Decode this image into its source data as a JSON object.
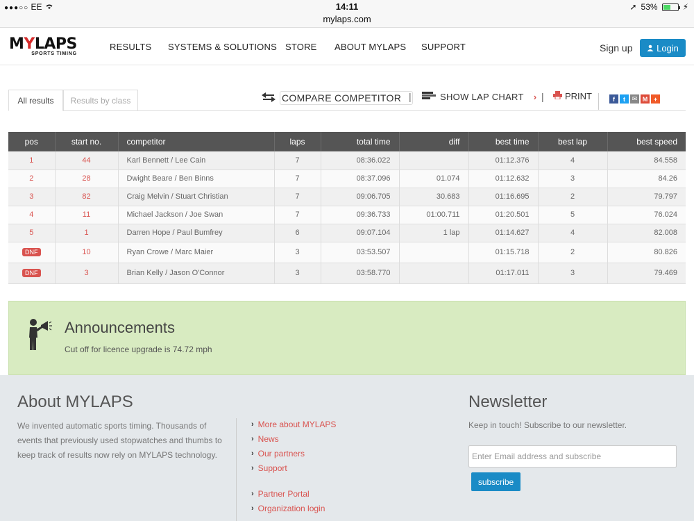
{
  "status_bar": {
    "carrier": "EE",
    "time": "14:11",
    "url": "mylaps.com",
    "battery": "53%",
    "battery_level": 0.53
  },
  "nav": {
    "logo_text": "MYLAPS",
    "logo_tagline": "SPORTS TIMING",
    "items": [
      "RESULTS",
      "SYSTEMS & SOLUTIONS",
      "STORE",
      "ABOUT MYLAPS",
      "SUPPORT"
    ],
    "signup": "Sign up",
    "login": "Login"
  },
  "tabs": {
    "all_results": "All results",
    "results_by_class": "Results by class"
  },
  "toolbar": {
    "compare": "COMPARE COMPETITOR",
    "lap_chart": "SHOW LAP CHART",
    "print": "PRINT",
    "separator": "|",
    "chevron": "›"
  },
  "share_icons": [
    {
      "name": "facebook-icon",
      "color": "#3b5998",
      "glyph": "f"
    },
    {
      "name": "twitter-icon",
      "color": "#1da1f2",
      "glyph": "t"
    },
    {
      "name": "email-icon",
      "color": "#888888",
      "glyph": "✉"
    },
    {
      "name": "gmail-icon",
      "color": "#dd4b39",
      "glyph": "M"
    },
    {
      "name": "more-share-icon",
      "color": "#f05a28",
      "glyph": "+"
    }
  ],
  "table": {
    "headers": [
      "pos",
      "start no.",
      "competitor",
      "laps",
      "total time",
      "diff",
      "best time",
      "best lap",
      "best speed"
    ],
    "rows": [
      {
        "pos": "1",
        "start": "44",
        "competitor": "Karl Bennett / Lee Cain",
        "laps": "7",
        "total": "08:36.022",
        "diff": "",
        "best_time": "01:12.376",
        "best_lap": "4",
        "speed": "84.558"
      },
      {
        "pos": "2",
        "start": "28",
        "competitor": "Dwight Beare / Ben Binns",
        "laps": "7",
        "total": "08:37.096",
        "diff": "01.074",
        "best_time": "01:12.632",
        "best_lap": "3",
        "speed": "84.26"
      },
      {
        "pos": "3",
        "start": "82",
        "competitor": "Craig Melvin / Stuart Christian",
        "laps": "7",
        "total": "09:06.705",
        "diff": "30.683",
        "best_time": "01:16.695",
        "best_lap": "2",
        "speed": "79.797"
      },
      {
        "pos": "4",
        "start": "11",
        "competitor": "Michael Jackson / Joe Swan",
        "laps": "7",
        "total": "09:36.733",
        "diff": "01:00.711",
        "best_time": "01:20.501",
        "best_lap": "5",
        "speed": "76.024"
      },
      {
        "pos": "5",
        "start": "1",
        "competitor": "Darren Hope / Paul Bumfrey",
        "laps": "6",
        "total": "09:07.104",
        "diff": "1 lap",
        "best_time": "01:14.627",
        "best_lap": "4",
        "speed": "82.008"
      },
      {
        "pos": "DNF",
        "start": "10",
        "competitor": "Ryan Crowe / Marc Maier",
        "laps": "3",
        "total": "03:53.507",
        "diff": "",
        "best_time": "01:15.718",
        "best_lap": "2",
        "speed": "80.826"
      },
      {
        "pos": "DNF",
        "start": "3",
        "competitor": "Brian Kelly / Jason O'Connor",
        "laps": "3",
        "total": "03:58.770",
        "diff": "",
        "best_time": "01:17.011",
        "best_lap": "3",
        "speed": "79.469"
      }
    ]
  },
  "announcements": {
    "title": "Announcements",
    "text": "Cut off for licence upgrade is 74.72 mph"
  },
  "footer": {
    "about_title": "About MYLAPS",
    "about_text": "We invented automatic sports timing. Thousands of events that previously used stopwatches and thumbs to keep track of results now rely on MYLAPS technology.",
    "links": [
      "More about MYLAPS",
      "News",
      "Our partners",
      "Support"
    ],
    "links2": [
      "Partner Portal",
      "Organization login"
    ],
    "newsletter_title": "Newsletter",
    "newsletter_text": "Keep in touch! Subscribe to our newsletter.",
    "email_placeholder": "Enter Email address and subscribe",
    "subscribe": "subscribe"
  }
}
